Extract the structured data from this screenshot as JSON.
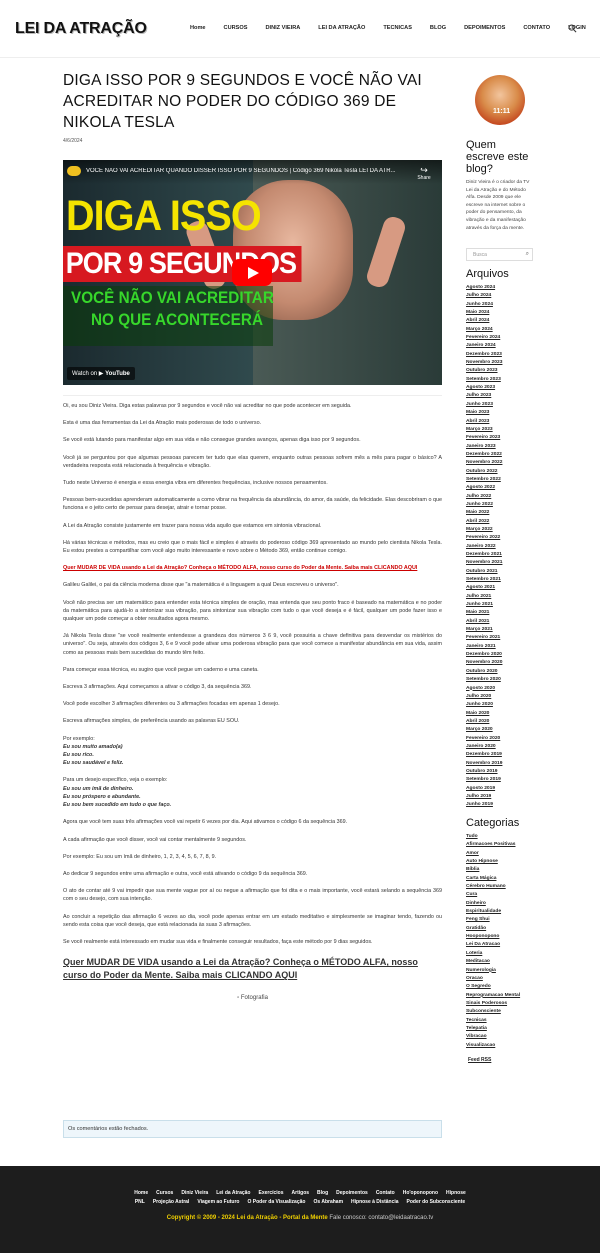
{
  "header": {
    "logo": "LEI DA ATRAÇÃO",
    "nav": [
      "Home",
      "Cursos",
      "Diniz Vieira",
      "Lei da Atração",
      "Tecnicas",
      "Blog",
      "Depoimentos",
      "Contato",
      "Login"
    ]
  },
  "post": {
    "title": "DIGA ISSO POR 9 SEGUNDOS E VOCÊ NÃO VAI ACREDITAR NO PODER DO CÓDIGO 369 DE NIKOLA TESLA",
    "date": "4/6/2024"
  },
  "video": {
    "title": "VOCÊ NÃO VAI ACREDITAR QUANDO DISSER ISSO POR 9 SEGUNDOS | Código 369 Nikola Tesla LEI DA ATR...",
    "share": "Share",
    "headline1": "DIGA ISSO",
    "headline2": "POR 9 SEGUNDOS",
    "sub1": "VOCÊ NÃO VAI ACREDITAR",
    "sub2": "NO QUE ACONTECERÁ",
    "watch_on": "Watch on",
    "youtube": "YouTube"
  },
  "content": {
    "p1": "Oi, eu sou Diniz Vieira. Diga estas palavras por 9 segundos e você não vai acreditar no que pode acontecer em seguida.",
    "p2": "Esta é uma das ferramentas da Lei da Atração mais poderosas de todo o universo.",
    "p3": "Se você está lutando para manifestar algo em sua vida e não consegue grandes avanços, apenas diga isso por 9 segundos.",
    "p4": "Você já se perguntou por que algumas pessoas parecem ter tudo que elas querem, enquanto outras pessoas sofrem mês a mês para pagar o básico? A verdadeira resposta está relacionada à frequência e vibração.",
    "p5": "Tudo neste Universo é energia e essa energia vibra em diferentes frequências, inclusive nossos pensamentos.",
    "p6": "Pessoas bem-sucedidas aprenderam automaticamente a como vibrar na frequência da abundância, do amor, da saúde, da felicidade. Elas descobriram o que funciona e o jeito certo de pensar para desejar, atrair e tornar posse.",
    "p7": "A Lei da Atração consiste justamente em trazer para nossa vida aquilo que estamos em sintonia vibracional.",
    "p8": "Há várias técnicas e métodos, mas eu creio que o mais fácil e simples é através do poderoso código 369 apresentado ao mundo pelo cientista Nikola Tesla. Eu estou prestes a compartilhar com você algo muito interessante e novo sobre o Método 369, então continue comigo.",
    "link1": "Quer MUDAR DE VIDA usando a Lei da Atração? Conheça o MÉTODO ALFA, nosso curso do Poder da Mente. Saiba mais CLICANDO AQUI",
    "p9": "Galileu Galilei, o pai da ciência moderna disse que \"a matemática é a linguagem a qual Deus escreveu o universo\".",
    "p10": "Você não precisa ser um matemático para entender esta técnica simples de oração, mas entenda que seu ponto fraco é baseado na matemática e no poder da matemática para ajudá-lo a sintonizar sua vibração, para sintonizar sua vibração com tudo o que você deseja e é fácil, qualquer um pode fazer isso e qualquer um pode começar a obter resultados agora mesmo.",
    "p11": "Já Nikola Tesla disse \"se você realmente entendesse a grandeza dos números 3 6 9, você possuiria a chave definitiva para desvendar os mistérios do universo\". Ou seja, através dos códigos 3, 6 e 9 você pode ativar uma poderosa vibração para que você comece a manifestar abundância em sua vida, assim como as pessoas mais bem sucedidas do mundo têm feito.",
    "p12": "Para começar essa técnica, eu sugiro que você pegue um caderno e uma caneta.",
    "p13": "Escreva 3 afirmações. Aqui começamos a ativar o código 3, da sequência 369.",
    "p14": "Você pode escolher 3 afirmações diferentes ou 3 afirmações focadas em apenas 1 desejo.",
    "p15": "Escreva afirmações simples, de preferência usando as palavras EU SOU.",
    "ex_label": "Por exemplo:",
    "ex1": [
      "Eu sou muito amado(a)",
      "Eu sou rico.",
      "Eu sou saudável e feliz."
    ],
    "ex2_label": "Para um desejo específico, veja o exemplo:",
    "ex2": [
      "Eu sou um ímã de dinheiro.",
      "Eu sou próspero e abundante.",
      "Eu sou bem sucedido em tudo o que faço."
    ],
    "p16": "Agora que você tem suas três afirmações você vai repetir 6 vezes por dia. Aqui ativamos o código 6 da sequência 369.",
    "p17": "A cada afirmação que você disser, você vai contar mentalmente 9 segundos.",
    "p18": "Por exemplo: Eu sou um ímã de dinheiro, 1, 2, 3, 4, 5, 6, 7, 8, 9.",
    "p19": "Ao dedicar 9 segundos entre uma afirmação e outra, você está ativando o código 9 da sequência 369.",
    "p20": "O ato de contar até 9 vai impedir que sua mente vague por aí ou negue a afirmação que foi dita e o mais importante, você estará selando a sequência 369 com o seu desejo, com sua intenção.",
    "p21": "Ao concluir a repetição das afirmação 6 vezes ao dia, você pode apenas entrar em um estado meditativo e simplesmente se imaginar tendo, fazendo ou sendo esta coisa que você deseja, que está relacionada às suas 3 afirmações.",
    "p22": "Se você realmente está interessado em mudar sua vida e finalmente conseguir resultados, faça este método por 9 dias seguidos.",
    "link2": "Quer MUDAR DE VIDA usando a Lei da Atração? Conheça o MÉTODO ALFA, nosso curso do Poder da Mente. Saiba mais CLICANDO AQUI",
    "img_alt": "Fotografia",
    "comments_closed": "Os comentários estão fechados."
  },
  "sidebar": {
    "avatar_text": "11:11",
    "about_title": "Quem escreve este blog?",
    "about_text": "Diniz Vieira é o criador da TV Lei da Atração e do Método Alfa. Desde 2009 que ele escreve na internet sobre o poder do pensamento, da vibração e da manifestação através da força da mente.",
    "search_placeholder": "Busca",
    "archives_title": "Arquivos",
    "archives": [
      "Agosto 2024",
      "Julho 2024",
      "Junho 2024",
      "Maio 2024",
      "Abril 2024",
      "Março 2024",
      "Fevereiro 2024",
      "Janeiro 2024",
      "Dezembro 2023",
      "Novembro 2023",
      "Outubro 2023",
      "Setembro 2023",
      "Agosto 2023",
      "Julho 2023",
      "Junho 2023",
      "Maio 2023",
      "Abril 2023",
      "Março 2023",
      "Fevereiro 2023",
      "Janeiro 2023",
      "Dezembro 2022",
      "Novembro 2022",
      "Outubro 2022",
      "Setembro 2022",
      "Agosto 2022",
      "Julho 2022",
      "Junho 2022",
      "Maio 2022",
      "Abril 2022",
      "Março 2022",
      "Fevereiro 2022",
      "Janeiro 2022",
      "Dezembro 2021",
      "Novembro 2021",
      "Outubro 2021",
      "Setembro 2021",
      "Agosto 2021",
      "Julho 2021",
      "Junho 2021",
      "Maio 2021",
      "Abril 2021",
      "Março 2021",
      "Fevereiro 2021",
      "Janeiro 2021",
      "Dezembro 2020",
      "Novembro 2020",
      "Outubro 2020",
      "Setembro 2020",
      "Agosto 2020",
      "Julho 2020",
      "Junho 2020",
      "Maio 2020",
      "Abril 2020",
      "Março 2020",
      "Fevereiro 2020",
      "Janeiro 2020",
      "Dezembro 2019",
      "Novembro 2019",
      "Outubro 2019",
      "Setembro 2019",
      "Agosto 2019",
      "Julho 2019",
      "Junho 2019"
    ],
    "categories_title": "Categorias",
    "categories": [
      "Tudo",
      "Afirmacoes Positivas",
      "Amor",
      "Auto Hipnose",
      "Bíblia",
      "Carta Mágica",
      "Cérebro Humano",
      "Cura",
      "Dinheiro",
      "Espiritualidade",
      "Feng Shui",
      "Gratidão",
      "Hooponopono",
      "Lei Da Atracao",
      "Loteria",
      "Meditacao",
      "Numerologia",
      "Oracao",
      "O Segredo",
      "Reprogramacao Mental",
      "Sinais Poderosos",
      "Subconsciente",
      "Tecnicas",
      "Telepatia",
      "Vibracao",
      "Visualizacao"
    ],
    "feed": "Feed RSS"
  },
  "footer": {
    "nav1": [
      "Home",
      "Cursos",
      "Diniz Vieira",
      "Lei da Atração",
      "Exercícios",
      "Artigos",
      "Blog",
      "Depoimentos",
      "Contato",
      "Ho'oponopono",
      "Hipnose"
    ],
    "nav2": [
      "PNL",
      "Projeção Astral",
      "Viagem ao Futuro",
      "O Poder da Visualização",
      "Os Abraham",
      "Hipnose à Distância",
      "Poder do Subconsciente"
    ],
    "copyright": "Copyright © 2009 - 2024 Lei da Atração - Portal da Mente",
    "contact": "Fale conosco: contato@leidaatracao.tv"
  }
}
